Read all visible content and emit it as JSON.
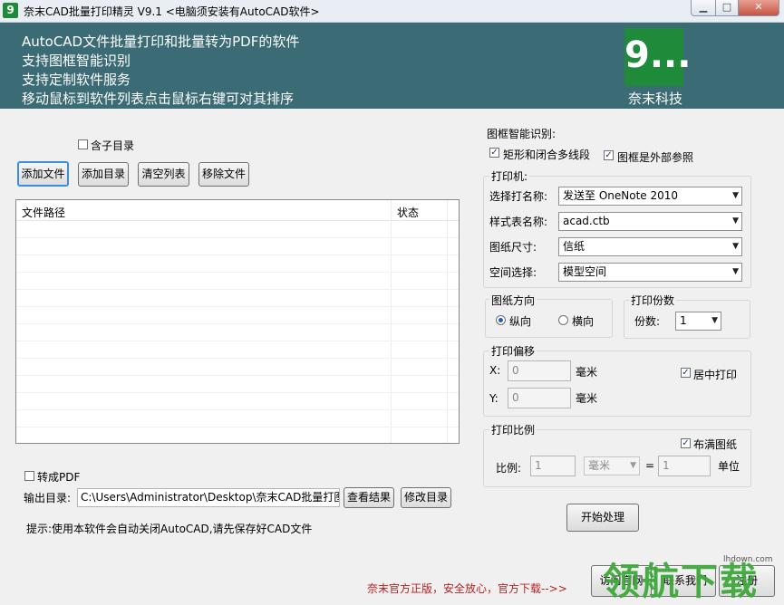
{
  "window": {
    "title": "奈末CAD批量打印精灵   V9.1  <电脑须安装有AutoCAD软件>",
    "icon_glyph": "9",
    "min_glyph": "▁",
    "max_glyph": "□",
    "close_glyph": "✕"
  },
  "banner": {
    "lines": [
      "AutoCAD文件批量打印和批量转为PDF的软件",
      "支持图框智能识别",
      "支持定制软件服务",
      "移动鼠标到软件列表点击鼠标右键可对其排序"
    ],
    "logo_glyph": "9...",
    "logo_text": "奈末科技"
  },
  "files": {
    "include_subdirs_label": "含子目录",
    "include_subdirs_checked": false,
    "buttons": {
      "add_file": "添加文件",
      "add_dir": "添加目录",
      "clear_list": "清空列表",
      "remove_file": "移除文件"
    },
    "columns": [
      "文件路径",
      "状态"
    ],
    "rows": []
  },
  "output": {
    "to_pdf_label": "转成PDF",
    "to_pdf_checked": false,
    "dir_label": "输出目录:",
    "dir_value": "C:\\Users\\Administrator\\Desktop\\奈末CAD批量打图精",
    "view_result": "查看结果",
    "change_dir": "修改目录"
  },
  "hint": "提示:使用本软件会自动关闭AutoCAD,请先保存好CAD文件",
  "frame_recognition": {
    "title": "图框智能识别:",
    "rect_label": "矩形和闭合多线段",
    "rect_checked": true,
    "xref_label": "图框是外部参照",
    "xref_checked": true
  },
  "printer": {
    "title": "打印机:",
    "fields": [
      {
        "label": "选择打名称:",
        "value": "发送至 OneNote 2010"
      },
      {
        "label": "样式表名称:",
        "value": "acad.ctb"
      },
      {
        "label": "图纸尺寸:",
        "value": "信纸"
      },
      {
        "label": "空间选择:",
        "value": "模型空间"
      }
    ]
  },
  "orientation": {
    "title": "图纸方向",
    "portrait": "纵向",
    "landscape": "横向",
    "selected": "portrait"
  },
  "copies": {
    "title": "打印份数",
    "label": "份数:",
    "value": "1"
  },
  "offset": {
    "title": "打印偏移",
    "x_label": "X:",
    "x_value": "0",
    "y_label": "Y:",
    "y_value": "0",
    "unit": "毫米",
    "center_label": "居中打印",
    "center_checked": true
  },
  "scale": {
    "title": "打印比例",
    "fit_label": "布满图纸",
    "fit_checked": true,
    "ratio_label": "比例:",
    "ratio_value": "1",
    "unit_value": "毫米",
    "equals": "=",
    "units_value": "1",
    "units_label": "单位"
  },
  "start_button": "开始处理",
  "footer": {
    "notice": "奈末官方正版，安全放心，官方下载-->>",
    "visit_site": "访问官网",
    "contact": "联系我们",
    "register": "注册"
  },
  "watermark": {
    "text": "领航下载",
    "url": "lhdown.com"
  },
  "colors": {
    "banner": "#3b6b75",
    "logo_green": "#1f8a3a",
    "notice_red": "#b22222"
  }
}
